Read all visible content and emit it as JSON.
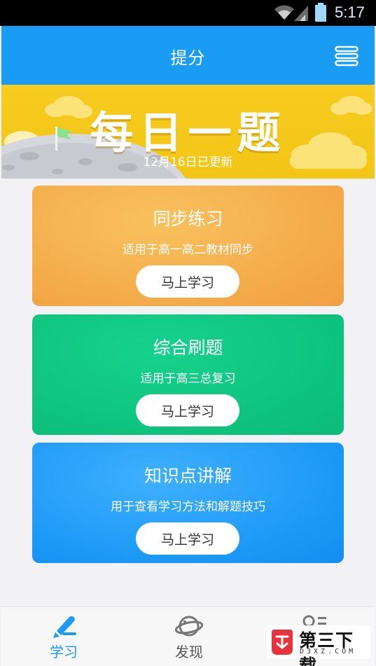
{
  "status_bar": {
    "time": "5:17"
  },
  "app_bar": {
    "title": "提分"
  },
  "banner": {
    "headline": "每日一题",
    "update_text": "12月16日已更新"
  },
  "cards": [
    {
      "title": "同步练习",
      "description": "适用于高一高二教材同步",
      "button_label": "马上学习",
      "color": "#f4a948"
    },
    {
      "title": "综合刷题",
      "description": "适用于高三总复习",
      "button_label": "马上学习",
      "color": "#0ec27e"
    },
    {
      "title": "知识点讲解",
      "description": "用于查看学习方法和解题技巧",
      "button_label": "马上学习",
      "color": "#1a98f6"
    }
  ],
  "bottom_nav": {
    "items": [
      {
        "label": "学习",
        "icon": "pencil-icon",
        "active": true
      },
      {
        "label": "发现",
        "icon": "planet-icon",
        "active": false
      },
      {
        "label": "",
        "icon": "profile-list-icon",
        "active": false
      }
    ]
  },
  "watermark": {
    "name": "第三下载",
    "domain": "D3XZ.COM"
  },
  "colors": {
    "primary": "#1a9cf5",
    "banner": "#f3c517"
  }
}
